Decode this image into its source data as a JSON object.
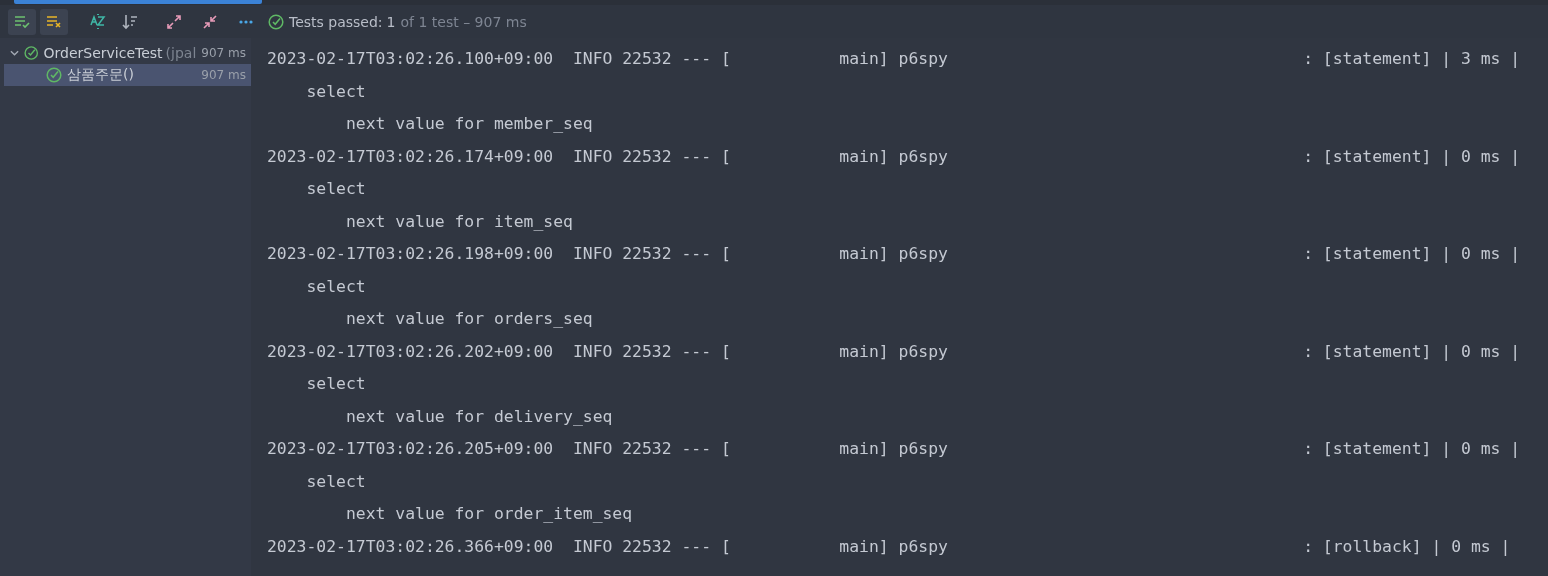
{
  "toolbar": {
    "buttons": [
      {
        "kind": "show-passed",
        "selected": true
      },
      {
        "kind": "show-ignored",
        "selected": true
      },
      {
        "kind": "sort-alpha",
        "selected": false
      },
      {
        "kind": "sort-duration",
        "selected": false
      },
      {
        "kind": "expand",
        "selected": false
      },
      {
        "kind": "collapse",
        "selected": false
      },
      {
        "kind": "more",
        "selected": false
      }
    ],
    "status": {
      "label": "Tests passed:",
      "count": "1",
      "rest": "of 1 test – 907 ms"
    }
  },
  "tree": [
    {
      "name": "OrderServiceTest",
      "hint": "(jpal",
      "time": "907 ms",
      "expanded": true,
      "selected": false,
      "children": [
        {
          "name": "삼품주문()",
          "time": "907 ms",
          "selected": true
        }
      ]
    }
  ],
  "console": [
    {
      "header": "2023-02-17T03:02:26.100+09:00  INFO 22532 --- [           main] p6spy",
      "tail": ": [statement] | 3 ms |",
      "lines": [
        {
          "text": "select",
          "children": [
            {
              "text": "next value for member_seq"
            }
          ]
        }
      ]
    },
    {
      "header": "2023-02-17T03:02:26.174+09:00  INFO 22532 --- [           main] p6spy",
      "tail": ": [statement] | 0 ms |",
      "lines": [
        {
          "text": "select",
          "children": [
            {
              "text": "next value for item_seq"
            }
          ]
        }
      ]
    },
    {
      "header": "2023-02-17T03:02:26.198+09:00  INFO 22532 --- [           main] p6spy",
      "tail": ": [statement] | 0 ms |",
      "lines": [
        {
          "text": "select",
          "children": [
            {
              "text": "next value for orders_seq"
            }
          ]
        }
      ]
    },
    {
      "header": "2023-02-17T03:02:26.202+09:00  INFO 22532 --- [           main] p6spy",
      "tail": ": [statement] | 0 ms |",
      "lines": [
        {
          "text": "select",
          "children": [
            {
              "text": "next value for delivery_seq"
            }
          ]
        }
      ]
    },
    {
      "header": "2023-02-17T03:02:26.205+09:00  INFO 22532 --- [           main] p6spy",
      "tail": ": [statement] | 0 ms |",
      "lines": [
        {
          "text": "select",
          "children": [
            {
              "text": "next value for order_item_seq"
            }
          ]
        }
      ]
    },
    {
      "header": "2023-02-17T03:02:26.366+09:00  INFO 22532 --- [           main] p6spy",
      "tail": ": [rollback] | 0 ms |"
    }
  ]
}
